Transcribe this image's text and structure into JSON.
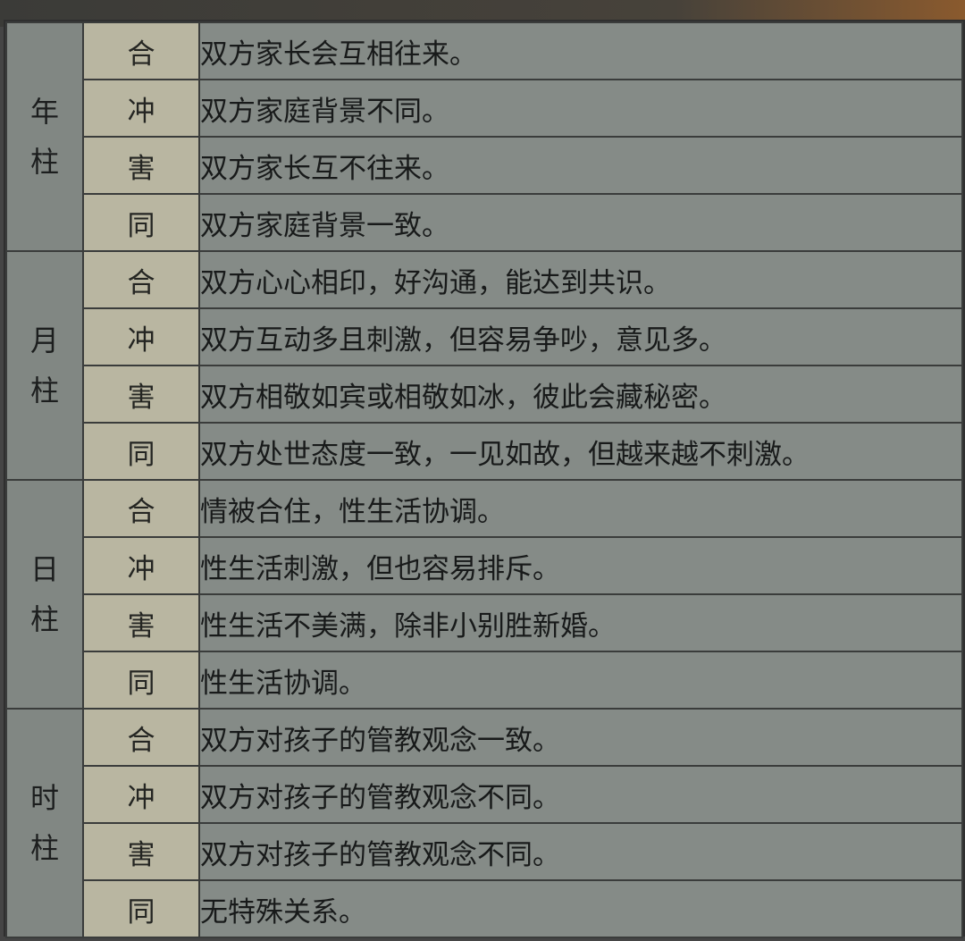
{
  "pillars": [
    {
      "name": "年柱",
      "rows": [
        {
          "relation": "合",
          "text": "双方家长会互相往来。"
        },
        {
          "relation": "冲",
          "text": "双方家庭背景不同。"
        },
        {
          "relation": "害",
          "text": "双方家长互不往来。"
        },
        {
          "relation": "同",
          "text": "双方家庭背景一致。"
        }
      ]
    },
    {
      "name": "月柱",
      "rows": [
        {
          "relation": "合",
          "text": "双方心心相印，好沟通，能达到共识。"
        },
        {
          "relation": "冲",
          "text": "双方互动多且刺激，但容易争吵，意见多。"
        },
        {
          "relation": "害",
          "text": "双方相敬如宾或相敬如冰，彼此会藏秘密。"
        },
        {
          "relation": "同",
          "text": "双方处世态度一致，一见如故，但越来越不刺激。"
        }
      ]
    },
    {
      "name": "日柱",
      "rows": [
        {
          "relation": "合",
          "text": "情被合住，性生活协调。"
        },
        {
          "relation": "冲",
          "text": "性生活刺激，但也容易排斥。"
        },
        {
          "relation": "害",
          "text": "性生活不美满，除非小别胜新婚。"
        },
        {
          "relation": "同",
          "text": "性生活协调。"
        }
      ]
    },
    {
      "name": "时柱",
      "rows": [
        {
          "relation": "合",
          "text": "双方对孩子的管教观念一致。"
        },
        {
          "relation": "冲",
          "text": "双方对孩子的管教观念不同。"
        },
        {
          "relation": "害",
          "text": "双方对孩子的管教观念不同。"
        },
        {
          "relation": "同",
          "text": "无特殊关系。"
        }
      ]
    }
  ]
}
